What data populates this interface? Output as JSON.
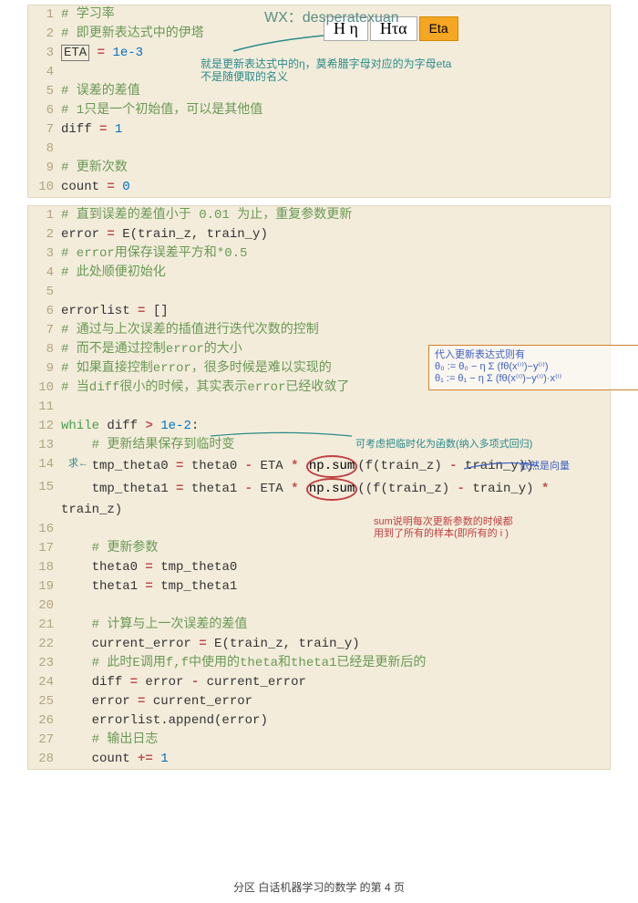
{
  "watermark": "WX：desperatexuan",
  "badges": {
    "b1": "H η",
    "b2": "Hτα",
    "b3": "Eta"
  },
  "block1": [
    {
      "n": "1",
      "seg": [
        {
          "c": "comment",
          "t": "# 学习率"
        }
      ]
    },
    {
      "n": "2",
      "seg": [
        {
          "c": "comment",
          "t": "# 即更新表达式中的伊塔"
        }
      ]
    },
    {
      "n": "3",
      "seg": [
        {
          "c": "var boxed",
          "t": "ETA"
        },
        {
          "c": "var",
          "t": " "
        },
        {
          "c": "op",
          "t": "="
        },
        {
          "c": "var",
          "t": " "
        },
        {
          "c": "num",
          "t": "1e-3"
        }
      ]
    },
    {
      "n": "4",
      "seg": []
    },
    {
      "n": "5",
      "seg": [
        {
          "c": "comment",
          "t": "# 误差的差值"
        }
      ]
    },
    {
      "n": "6",
      "seg": [
        {
          "c": "comment",
          "t": "# 1只是一个初始值，可以是其他值"
        }
      ]
    },
    {
      "n": "7",
      "seg": [
        {
          "c": "var",
          "t": "diff "
        },
        {
          "c": "op",
          "t": "="
        },
        {
          "c": "var",
          "t": " "
        },
        {
          "c": "num",
          "t": "1"
        }
      ]
    },
    {
      "n": "8",
      "seg": []
    },
    {
      "n": "9",
      "seg": [
        {
          "c": "comment",
          "t": "# 更新次数"
        }
      ]
    },
    {
      "n": "10",
      "seg": [
        {
          "c": "var",
          "t": "count "
        },
        {
          "c": "op",
          "t": "="
        },
        {
          "c": "var",
          "t": " "
        },
        {
          "c": "num",
          "t": "0"
        }
      ]
    }
  ],
  "block2": [
    {
      "n": "1",
      "seg": [
        {
          "c": "comment",
          "t": "# 直到误差的差值小于 0.01 为止，重复参数更新"
        }
      ]
    },
    {
      "n": "2",
      "seg": [
        {
          "c": "var",
          "t": "error "
        },
        {
          "c": "op",
          "t": "="
        },
        {
          "c": "var",
          "t": " E(train_z, train_y)"
        }
      ]
    },
    {
      "n": "3",
      "seg": [
        {
          "c": "comment",
          "t": "# error用保存误差平方和*0.5"
        }
      ]
    },
    {
      "n": "4",
      "seg": [
        {
          "c": "comment",
          "t": "# 此处顺便初始化"
        }
      ]
    },
    {
      "n": "5",
      "seg": []
    },
    {
      "n": "6",
      "seg": [
        {
          "c": "var",
          "t": "errorlist "
        },
        {
          "c": "op",
          "t": "="
        },
        {
          "c": "var",
          "t": " []"
        }
      ]
    },
    {
      "n": "7",
      "seg": [
        {
          "c": "comment",
          "t": "# 通过与上次误差的插值进行迭代次数的控制"
        }
      ]
    },
    {
      "n": "8",
      "seg": [
        {
          "c": "comment",
          "t": "# 而不是通过控制error的大小"
        }
      ]
    },
    {
      "n": "9",
      "seg": [
        {
          "c": "comment",
          "t": "# 如果直接控制error，很多时候是难以实现的"
        }
      ]
    },
    {
      "n": "10",
      "seg": [
        {
          "c": "comment",
          "t": "# 当diff很小的时候，其实表示error已经收敛了"
        }
      ]
    },
    {
      "n": "11",
      "seg": []
    },
    {
      "n": "12",
      "seg": [
        {
          "c": "kw2",
          "t": "while"
        },
        {
          "c": "var",
          "t": " diff "
        },
        {
          "c": "op",
          "t": ">"
        },
        {
          "c": "var",
          "t": " "
        },
        {
          "c": "num",
          "t": "1e-2"
        },
        {
          "c": "var",
          "t": ":"
        }
      ]
    },
    {
      "n": "13",
      "seg": [
        {
          "c": "var",
          "t": "    "
        },
        {
          "c": "comment",
          "t": "# 更新结果保存到临时变"
        }
      ]
    },
    {
      "n": "14",
      "seg": [
        {
          "c": "var",
          "t": "    tmp_theta0 "
        },
        {
          "c": "op",
          "t": "="
        },
        {
          "c": "var",
          "t": " theta0 "
        },
        {
          "c": "op",
          "t": "-"
        },
        {
          "c": "var",
          "t": " ETA "
        },
        {
          "c": "op",
          "t": "*"
        },
        {
          "c": "var",
          "t": " "
        },
        {
          "c": "circle",
          "t": "np.sum"
        },
        {
          "c": "var",
          "t": "(f(train_z) "
        },
        {
          "c": "op",
          "t": "-"
        },
        {
          "c": "var",
          "t": " train_y))"
        }
      ]
    },
    {
      "n": "15",
      "seg": [
        {
          "c": "var",
          "t": "    tmp_theta1 "
        },
        {
          "c": "op",
          "t": "="
        },
        {
          "c": "var",
          "t": " theta1 "
        },
        {
          "c": "op",
          "t": "-"
        },
        {
          "c": "var",
          "t": " ETA "
        },
        {
          "c": "op",
          "t": "*"
        },
        {
          "c": "var",
          "t": " "
        },
        {
          "c": "circle",
          "t": "np.sum"
        },
        {
          "c": "var",
          "t": "((f(train_z) "
        },
        {
          "c": "op",
          "t": "-"
        },
        {
          "c": "var",
          "t": " train_y) "
        },
        {
          "c": "op",
          "t": "*"
        },
        {
          "c": "var",
          "t": " train_z)"
        }
      ]
    },
    {
      "n": "16",
      "seg": []
    },
    {
      "n": "17",
      "seg": [
        {
          "c": "var",
          "t": "    "
        },
        {
          "c": "comment",
          "t": "# 更新参数"
        }
      ]
    },
    {
      "n": "18",
      "seg": [
        {
          "c": "var",
          "t": "    theta0 "
        },
        {
          "c": "op",
          "t": "="
        },
        {
          "c": "var",
          "t": " tmp_theta0"
        }
      ]
    },
    {
      "n": "19",
      "seg": [
        {
          "c": "var",
          "t": "    theta1 "
        },
        {
          "c": "op",
          "t": "="
        },
        {
          "c": "var",
          "t": " tmp_theta1"
        }
      ]
    },
    {
      "n": "20",
      "seg": []
    },
    {
      "n": "21",
      "seg": [
        {
          "c": "var",
          "t": "    "
        },
        {
          "c": "comment",
          "t": "# 计算与上一次误差的差值"
        }
      ]
    },
    {
      "n": "22",
      "seg": [
        {
          "c": "var",
          "t": "    current_error "
        },
        {
          "c": "op",
          "t": "="
        },
        {
          "c": "var",
          "t": " E(train_z, train_y)"
        }
      ]
    },
    {
      "n": "23",
      "seg": [
        {
          "c": "var",
          "t": "    "
        },
        {
          "c": "comment",
          "t": "# 此时E调用f,f中使用的theta和theta1已经是更新后的"
        }
      ]
    },
    {
      "n": "24",
      "seg": [
        {
          "c": "var",
          "t": "    diff "
        },
        {
          "c": "op",
          "t": "="
        },
        {
          "c": "var",
          "t": " error "
        },
        {
          "c": "op",
          "t": "-"
        },
        {
          "c": "var",
          "t": " current_error"
        }
      ]
    },
    {
      "n": "25",
      "seg": [
        {
          "c": "var",
          "t": "    error "
        },
        {
          "c": "op",
          "t": "="
        },
        {
          "c": "var",
          "t": " current_error"
        }
      ]
    },
    {
      "n": "26",
      "seg": [
        {
          "c": "var",
          "t": "    errorlist.append(error)"
        }
      ]
    },
    {
      "n": "27",
      "seg": [
        {
          "c": "var",
          "t": "    "
        },
        {
          "c": "comment",
          "t": "# 输出日志"
        }
      ]
    },
    {
      "n": "28",
      "seg": [
        {
          "c": "var",
          "t": "    count "
        },
        {
          "c": "op",
          "t": "+="
        },
        {
          "c": "var",
          "t": " "
        },
        {
          "c": "num",
          "t": "1"
        }
      ]
    }
  ],
  "ann": {
    "a1_line1": "就是更新表达式中的η，莫希腊字母对应的为字母eta",
    "a1_line2": "不是随便取的名义",
    "a2": "代入更新表达式则有",
    "a2b": "θ₀ := θ₀ − η Σ (fθ(x⁽ⁱ⁾)−y⁽ⁱ⁾)",
    "a2c": "θ₁ := θ₁ − η Σ (fθ(x⁽ⁱ⁾)−y⁽ⁱ⁾)·x⁽ⁱ⁾",
    "a3": "可考虑把临时化为函数(纳入多项式回归)",
    "a4": "依然是向量",
    "a5": "求←",
    "a6": "sum说明每次更新参数的时候都",
    "a6b": "用到了所有的样本(即所有的 i )"
  },
  "footer": "分区 白话机器学习的数学 的第 4 页"
}
